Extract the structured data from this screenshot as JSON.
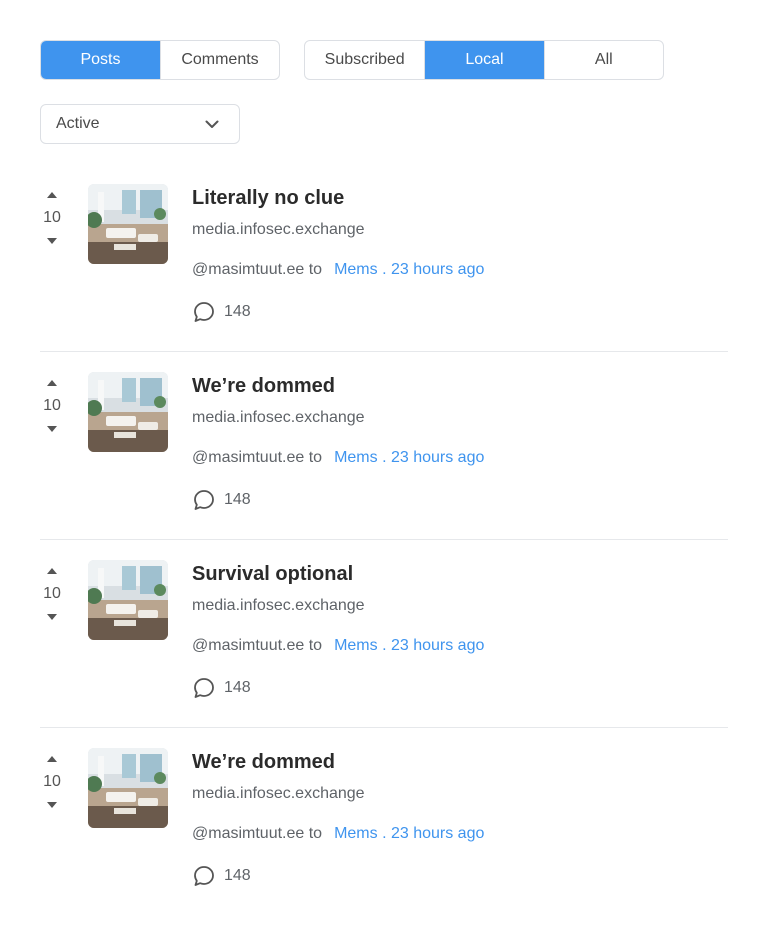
{
  "filters": {
    "type_tabs": [
      {
        "label": "Posts",
        "active": true
      },
      {
        "label": "Comments",
        "active": false
      }
    ],
    "listing_tabs": [
      {
        "label": "Subscribed",
        "active": false
      },
      {
        "label": "Local",
        "active": true
      },
      {
        "label": "All",
        "active": false
      }
    ],
    "sort": {
      "selected": "Active",
      "icon": "chevron-down-icon"
    }
  },
  "colors": {
    "accent": "#3f94ee",
    "border": "#dcdfe4",
    "text": "#2b2b2b",
    "muted": "#5f6368"
  },
  "posts": [
    {
      "score": "10",
      "title": "Literally no clue",
      "domain": "media.infosec.exchange",
      "author": "@masimtuut.ee to",
      "community": "Mems . 23 hours ago",
      "comments": "148"
    },
    {
      "score": "10",
      "title": "We’re dommed",
      "domain": "media.infosec.exchange",
      "author": "@masimtuut.ee to",
      "community": "Mems . 23 hours ago",
      "comments": "148"
    },
    {
      "score": "10",
      "title": "Survival optional",
      "domain": "media.infosec.exchange",
      "author": "@masimtuut.ee to",
      "community": "Mems . 23 hours ago",
      "comments": "148"
    },
    {
      "score": "10",
      "title": "We’re dommed",
      "domain": "media.infosec.exchange",
      "author": "@masimtuut.ee to",
      "community": "Mems . 23 hours ago",
      "comments": "148"
    }
  ]
}
